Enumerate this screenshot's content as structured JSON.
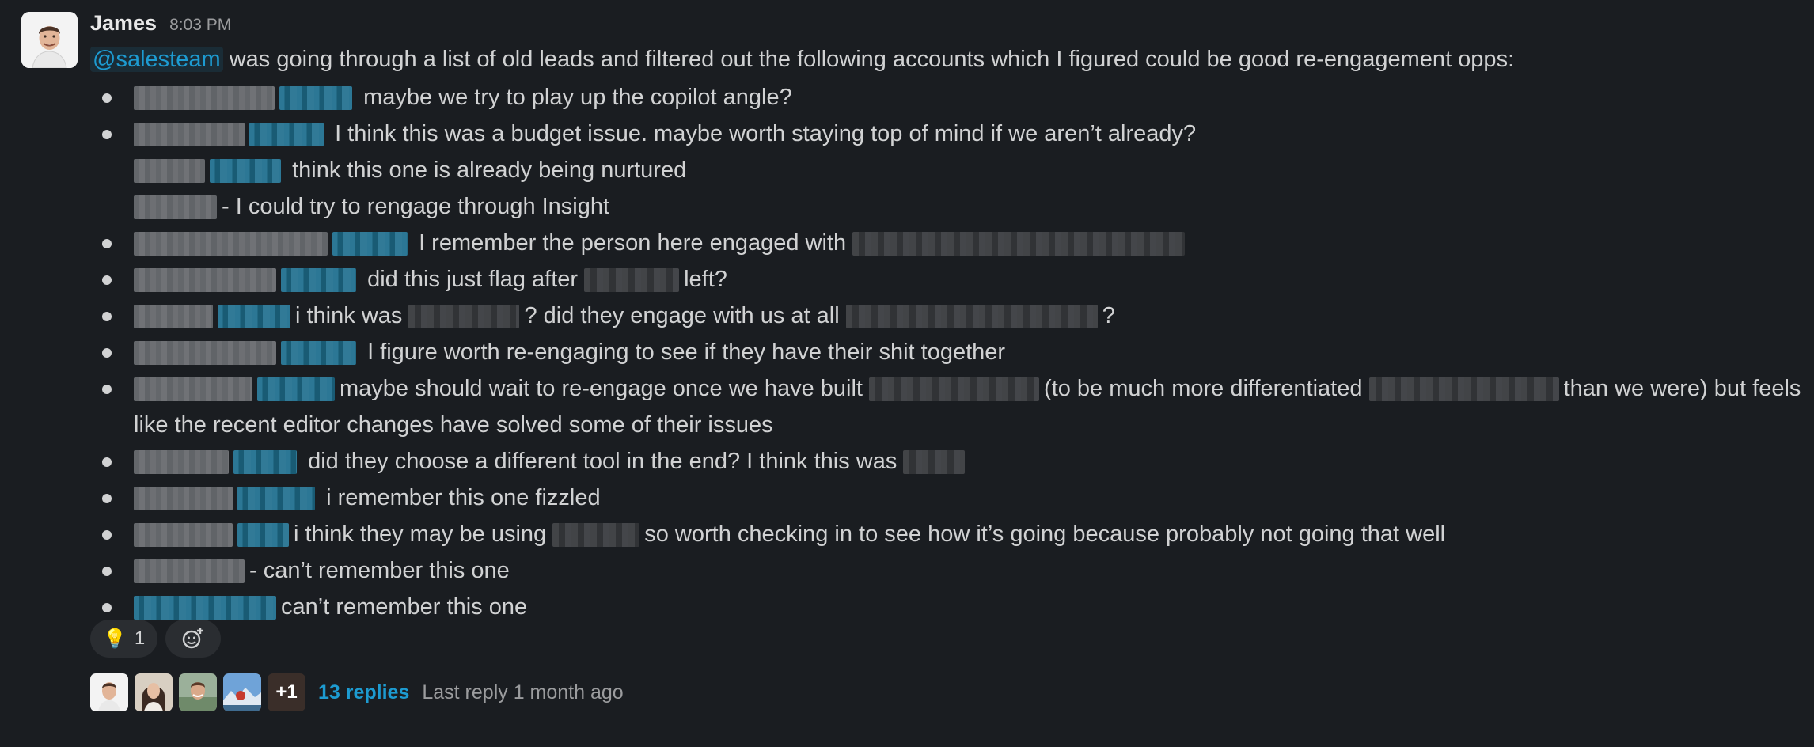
{
  "message": {
    "author": "James",
    "timestamp": "8:03 PM",
    "mention": "@salesteam",
    "intro": "was going through a list of old leads and filtered out the following accounts which I figured could be good re-engagement opps:",
    "items": [
      {
        "note": "maybe we try to play up the copilot angle?"
      },
      {
        "note": "I think this was a budget issue. maybe worth staying top of mind if we aren’t already?"
      },
      {
        "note": "think this one is already being nurtured"
      },
      {
        "note": "- I could try to rengage through Insight"
      },
      {
        "note": "I remember the person here engaged with"
      },
      {
        "note_a": "did this just flag after",
        "note_b": "left?"
      },
      {
        "note_a": "i think was",
        "note_b": "? did they engage with us at all",
        "note_c": "?"
      },
      {
        "note": "I figure worth re-engaging to see if they have their shit together"
      },
      {
        "note_a": "maybe should wait to re-engage once we have built",
        "note_b": "(to be much more differentiated",
        "note_c": "than we were) but feels like the recent editor changes have solved some of their issues"
      },
      {
        "note": "did they choose a different tool in the end? I think this was"
      },
      {
        "note": "i remember this one fizzled"
      },
      {
        "note_a": "i think they may be using",
        "note_b": "so worth checking in to see how it’s going because probably not going that well"
      },
      {
        "note": "- can’t remember this one"
      },
      {
        "note": "can’t remember this one"
      }
    ],
    "reactions": [
      {
        "emoji": "💡",
        "icon": "lightbulb-icon",
        "count": "1"
      }
    ],
    "add_reaction_icon": "add-reaction-icon",
    "thread": {
      "more_count": "+1",
      "replies": "13 replies",
      "last_reply": "Last reply 1 month ago"
    }
  },
  "colors": {
    "background": "#1a1d21",
    "text": "#d1d2d3",
    "link": "#1d9bd1",
    "muted": "#9b9c9e",
    "pill": "#2a2d31"
  }
}
